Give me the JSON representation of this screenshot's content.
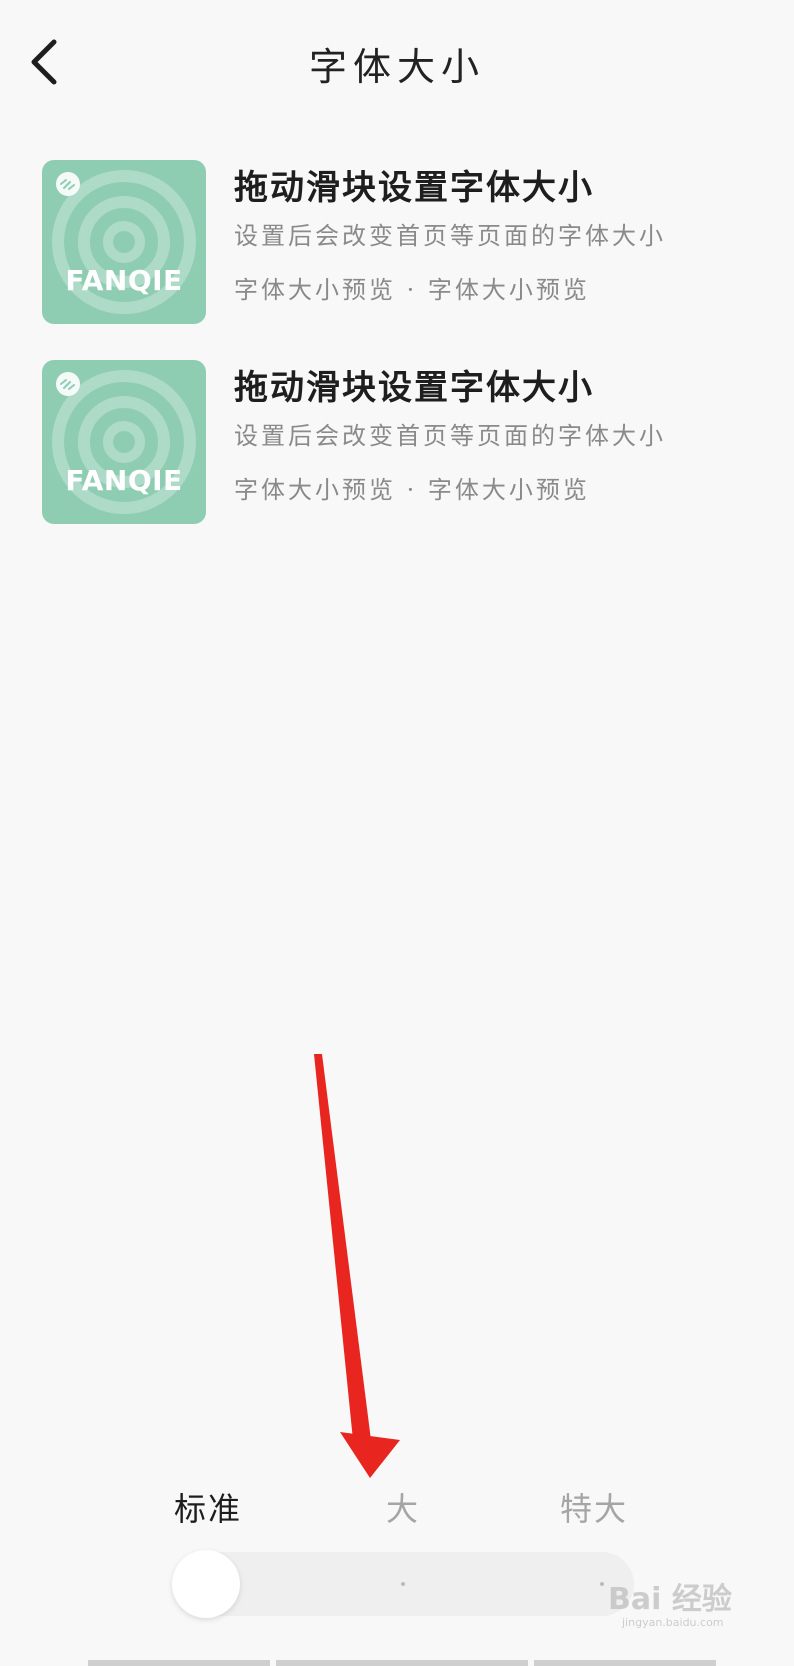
{
  "header": {
    "title": "字体大小",
    "back_icon": "chevron-left-icon"
  },
  "preview_items": [
    {
      "cover_text": "FANQIE",
      "title": "拖动滑块设置字体大小",
      "description": "设置后会改变首页等页面的字体大小",
      "meta": "字体大小预览 · 字体大小预览"
    },
    {
      "cover_text": "FANQIE",
      "title": "拖动滑块设置字体大小",
      "description": "设置后会改变首页等页面的字体大小",
      "meta": "字体大小预览 · 字体大小预览"
    }
  ],
  "font_size": {
    "options": [
      "标准",
      "大",
      "特大"
    ],
    "selected": "标准",
    "selected_index": 0
  },
  "watermark": {
    "brand": "Bai 经验",
    "url": "jingyan.baidu.com"
  },
  "colors": {
    "cover_bg": "#8fcdb3",
    "arrow": "#e8251f",
    "page_bg": "#f8f8f8"
  }
}
